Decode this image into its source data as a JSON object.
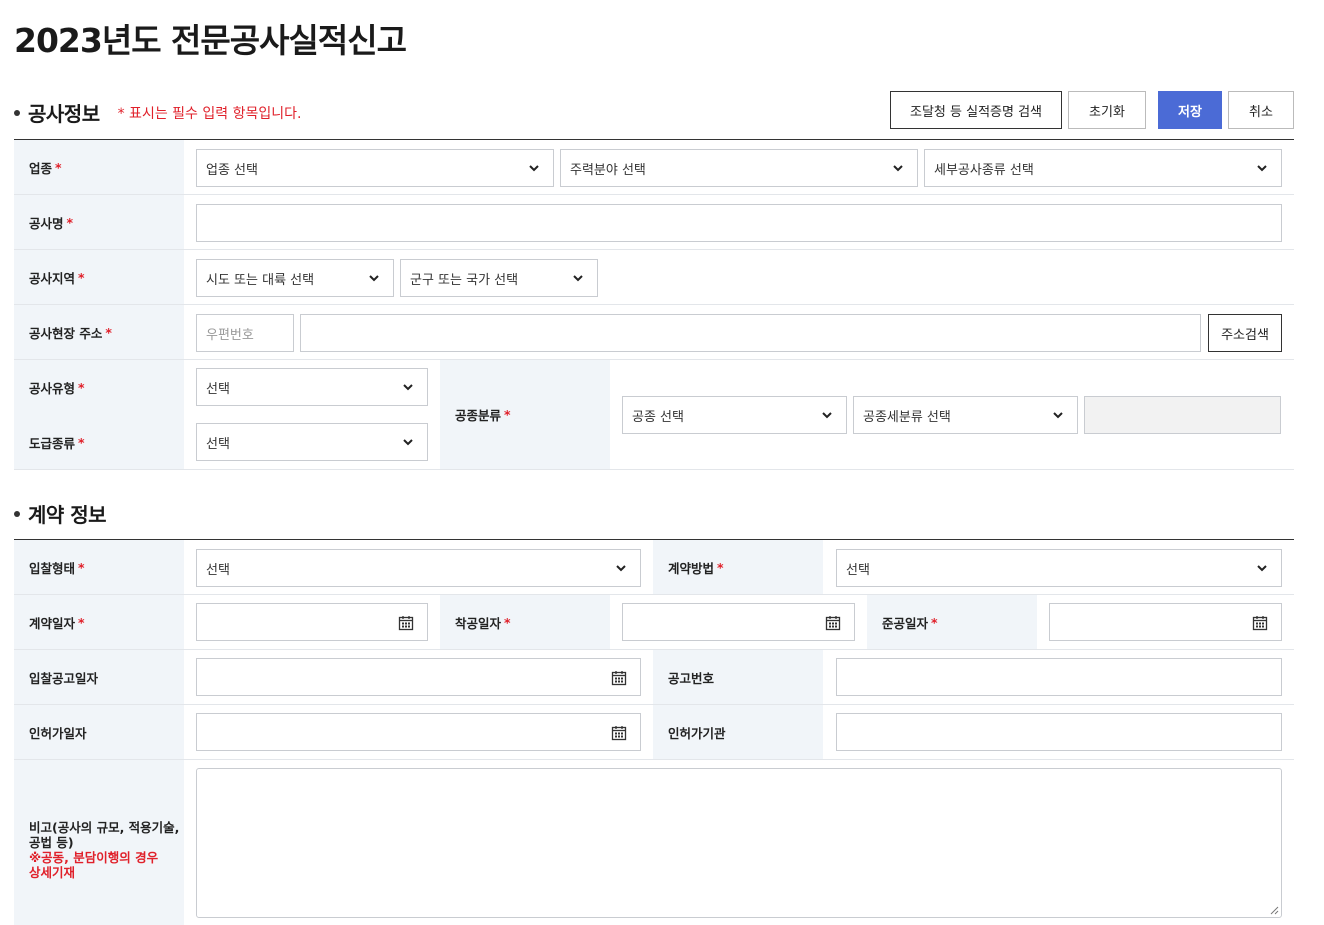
{
  "page": {
    "title": "2023년도 전문공사실적신고"
  },
  "section1": {
    "title": "공사정보",
    "note": "* 표시는 필수 입력 항목입니다.",
    "buttons": {
      "search": "조달청 등 실적증명 검색",
      "reset": "초기화",
      "save": "저장",
      "cancel": "취소"
    }
  },
  "fields": {
    "industry": {
      "label": "업종",
      "req": "*",
      "selects": [
        "업종 선택",
        "주력분야 선택",
        "세부공사종류 선택"
      ]
    },
    "project_name": {
      "label": "공사명",
      "req": "*",
      "value": ""
    },
    "region": {
      "label": "공사지역",
      "req": "*",
      "selects": [
        "시도 또는 대륙 선택",
        "군구 또는 국가 선택"
      ]
    },
    "address": {
      "label": "공사현장 주소",
      "req": "*",
      "zip_placeholder": "우편번호",
      "search_button": "주소검색"
    },
    "type": {
      "label": "공사유형",
      "req": "*",
      "select": "선택"
    },
    "contract_kind": {
      "label": "도급종류",
      "req": "*",
      "select": "선택"
    },
    "work_class": {
      "label": "공종분류",
      "req": "*",
      "selects": [
        "공종 선택",
        "공종세분류 선택"
      ]
    }
  },
  "section2": {
    "title": "계약 정보"
  },
  "contract": {
    "bid_type": {
      "label": "입찰형태",
      "req": "*",
      "select": "선택"
    },
    "method": {
      "label": "계약방법",
      "req": "*",
      "select": "선택"
    },
    "contract_date": {
      "label": "계약일자",
      "req": "*"
    },
    "start_date": {
      "label": "착공일자",
      "req": "*"
    },
    "end_date": {
      "label": "준공일자",
      "req": "*"
    },
    "notice_date": {
      "label": "입찰공고일자"
    },
    "notice_no": {
      "label": "공고번호"
    },
    "permit_date": {
      "label": "인허가일자"
    },
    "permit_org": {
      "label": "인허가기관"
    },
    "remarks": {
      "label_line1": "비고(공사의 규모, 적용기술,",
      "label_line2": "공법 등)",
      "note_line1": "※공동, 분담이행의 경우",
      "note_line2": "상세기재"
    }
  },
  "icons": {
    "select": "chevron-down-icon",
    "date": "calendar-icon",
    "resize": "resize-grip-icon"
  },
  "colors": {
    "primary": "#4b6bd6",
    "required": "#e0202a",
    "label_bg": "#f1f5f9"
  }
}
